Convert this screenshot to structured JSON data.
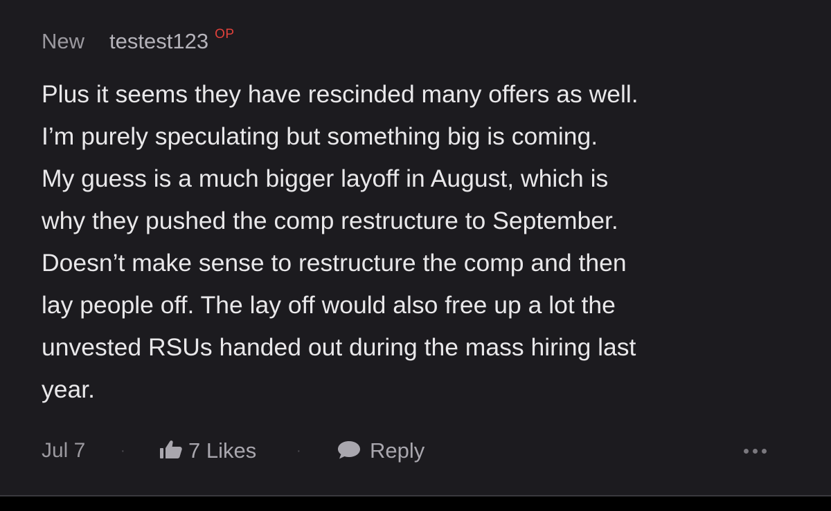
{
  "comment": {
    "board_tag": "New",
    "author": "testest123",
    "author_badge": "OP",
    "body_lines": [
      "Plus it seems they have rescinded many offers as well.",
      "I’m purely speculating but something big is coming.",
      "My guess is a much bigger layoff in August, which is",
      "why they pushed the comp restructure to September.",
      "Doesn’t make sense to restructure the comp and then",
      "lay people off. The lay off would also free up a lot the",
      "unvested RSUs handed out during the mass hiring last",
      "year."
    ],
    "date": "Jul 7",
    "separator": "·",
    "likes_label": "7 Likes",
    "reply_label": "Reply",
    "icons": {
      "like": "thumbs-up-icon",
      "reply": "speech-bubble-icon",
      "more": "more-dots-icon"
    }
  },
  "colors": {
    "background": "#1c1b1f",
    "body_text": "#e9e8ea",
    "muted_text": "#9b999f",
    "op_badge": "#e0413b"
  }
}
